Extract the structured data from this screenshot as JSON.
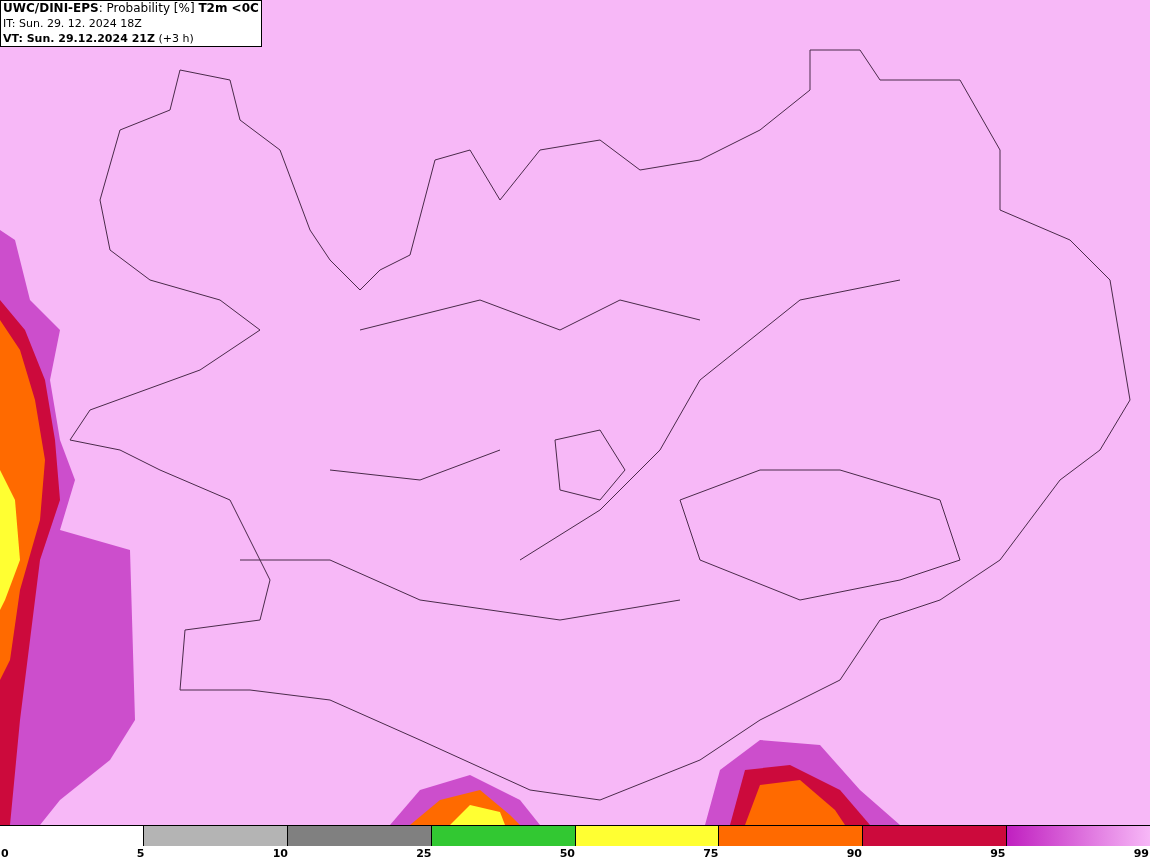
{
  "header": {
    "title": "**UWC/DINI-EPS**: Probability [%] **T2m <0C**",
    "it": "IT: Sun. 29. 12. 2024 18Z",
    "vt": "**VT: Sun. 29.12.2024 21Z** (+3 h)"
  },
  "legend": {
    "segments": [
      {
        "color": "#ffffff"
      },
      {
        "color": "#b4b4b4"
      },
      {
        "color": "#808080"
      },
      {
        "color": "#32c832"
      },
      {
        "color": "#ffff32"
      },
      {
        "color": "#ff6a00"
      },
      {
        "color": "#cc0a3c"
      },
      {
        "color": "#c020c0"
      }
    ],
    "labels": [
      "0",
      "5",
      "10",
      "25",
      "50",
      "75",
      "90",
      "95",
      "99"
    ]
  }
}
